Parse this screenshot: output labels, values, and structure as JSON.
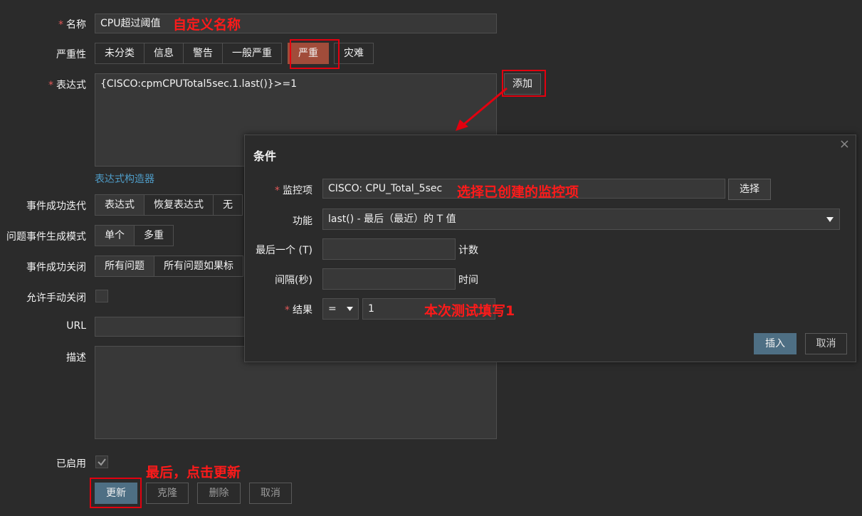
{
  "form": {
    "name_label": "名称",
    "name_value": "CPU超过阈值",
    "severity_label": "严重性",
    "severity_options": [
      "未分类",
      "信息",
      "警告",
      "一般严重",
      "严重",
      "灾难"
    ],
    "expression_label": "表达式",
    "expression_value": "{CISCO:cpmCPUTotal5sec.1.last()}>=1",
    "add_button": "添加",
    "expression_builder_link": "表达式构造器",
    "ok_event_gen_label": "事件成功迭代",
    "ok_event_gen_options": [
      "表达式",
      "恢复表达式",
      "无"
    ],
    "problem_gen_mode_label": "问题事件生成模式",
    "problem_gen_mode_options": [
      "单个",
      "多重"
    ],
    "ok_event_close_label": "事件成功关闭",
    "ok_event_close_options": [
      "所有问题",
      "所有问题如果标"
    ],
    "allow_manual_close_label": "允许手动关闭",
    "url_label": "URL",
    "description_label": "描述",
    "enabled_label": "已启用",
    "buttons": {
      "update": "更新",
      "clone": "克隆",
      "delete": "删除",
      "cancel": "取消"
    }
  },
  "modal": {
    "title": "条件",
    "close_symbol": "×",
    "item_label": "监控项",
    "item_value": "CISCO: CPU_Total_5sec",
    "select_button": "选择",
    "function_label": "功能",
    "function_value": "last() - 最后（最近）的 T 值",
    "last_t_label": "最后一个 (T)",
    "last_t_suffix": "计数",
    "interval_label": "间隔(秒)",
    "interval_suffix": "时间",
    "result_label": "结果",
    "result_operator": "=",
    "result_value": "1",
    "insert_button": "插入",
    "cancel_button": "取消"
  },
  "annotations": {
    "name": "自定义名称",
    "item": "选择已创建的监控项",
    "result": "本次测试填写1",
    "update": "最后，点击更新"
  },
  "colors": {
    "background": "#2b2b2b",
    "input": "#383838",
    "severity_high": "#a14c3a",
    "primary_button": "#4e6f84",
    "annotation": "#e3000f",
    "link": "#4f9dc8"
  }
}
